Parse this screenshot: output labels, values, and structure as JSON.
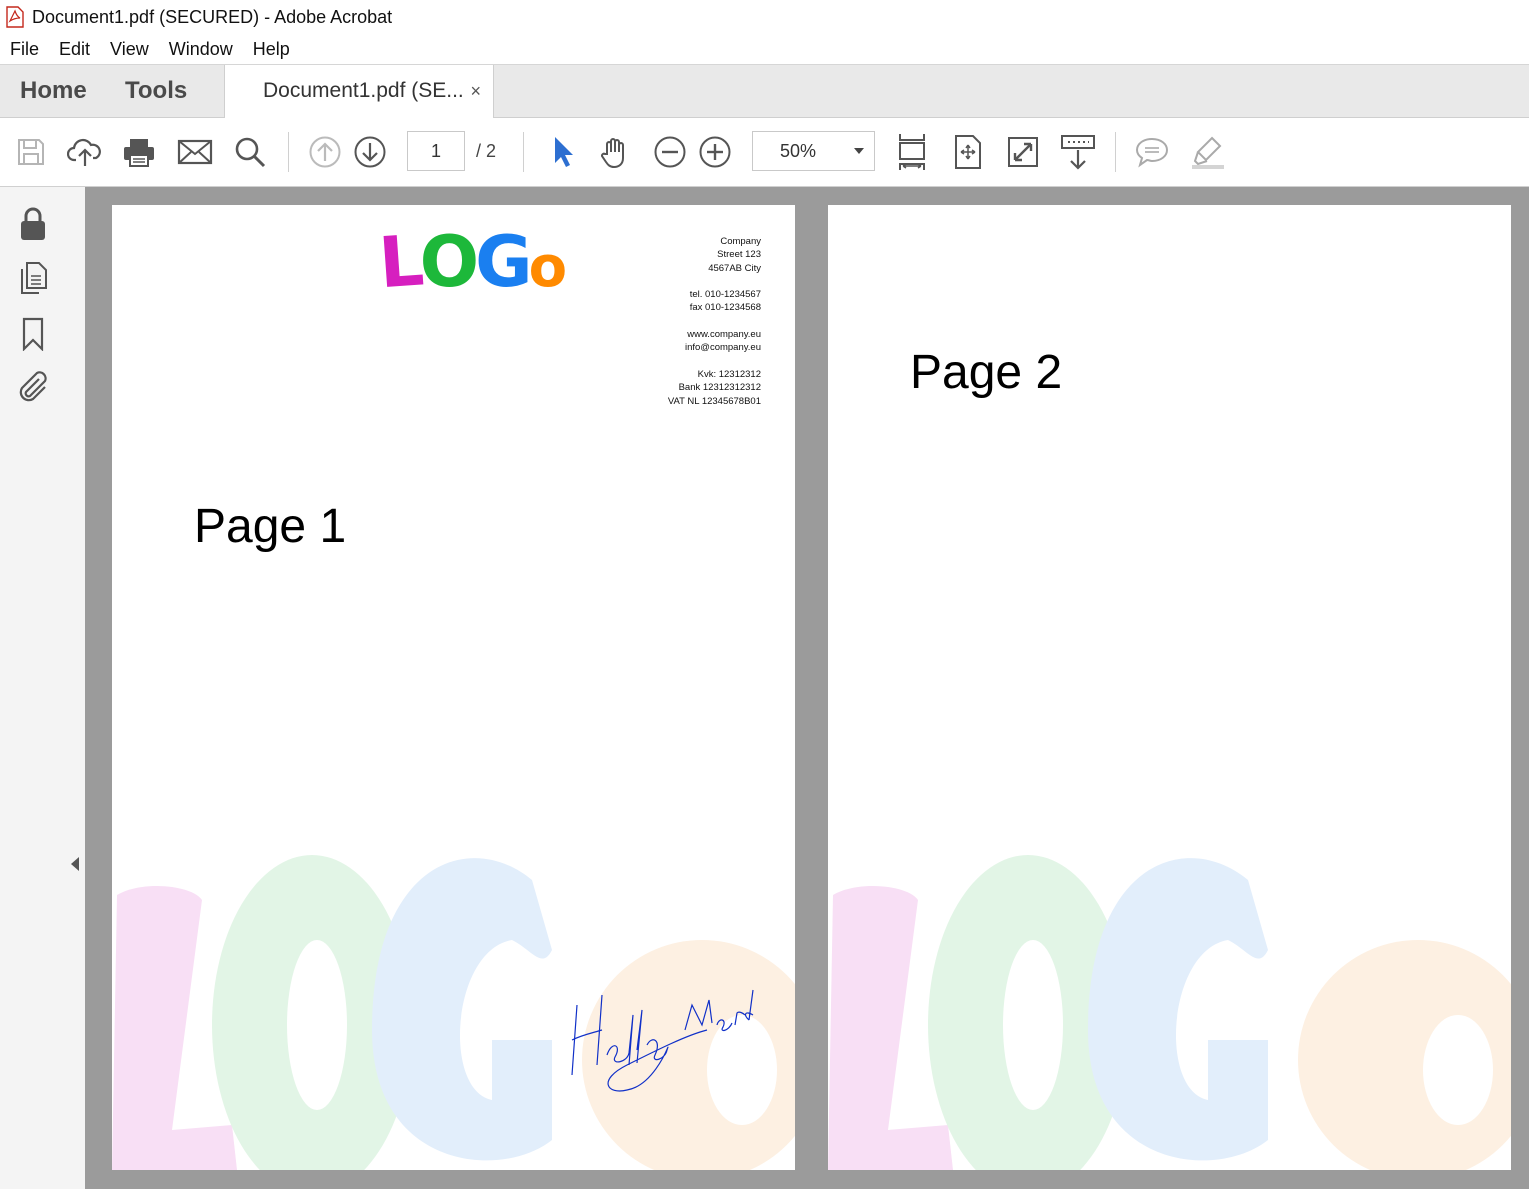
{
  "window": {
    "title": "Document1.pdf (SECURED) - Adobe Acrobat"
  },
  "menu": [
    "File",
    "Edit",
    "View",
    "Window",
    "Help"
  ],
  "tabs": {
    "home": "Home",
    "tools": "Tools",
    "document": "Document1.pdf (SE...",
    "close": "×"
  },
  "toolbar": {
    "page_current": "1",
    "page_total": "/ 2",
    "zoom": "50%",
    "icons": [
      "save-icon",
      "upload-cloud-icon",
      "print-icon",
      "email-icon",
      "search-icon",
      "page-up-icon",
      "page-down-icon",
      "select-cursor-icon",
      "hand-tool-icon",
      "zoom-out-icon",
      "zoom-in-icon",
      "fit-page-icon",
      "rotate-page-icon",
      "full-screen-icon",
      "read-mode-icon",
      "comment-icon",
      "highlight-pen-icon"
    ]
  },
  "sidebar": {
    "icons": [
      "lock-icon",
      "pages-icon",
      "bookmark-icon",
      "attachment-icon"
    ]
  },
  "pages": [
    {
      "label": "Page 1",
      "logo": "LOGO",
      "address": [
        "Company",
        "Street 123",
        "4567AB City",
        "",
        "tel. 010-1234567",
        "fax 010-1234568",
        "",
        "www.company.eu",
        "info@company.eu",
        "",
        "Kvk: 12312312",
        "Bank 12312312312",
        "VAT NL 12345678B01"
      ],
      "signature": "Hello World"
    },
    {
      "label": "Page 2"
    }
  ],
  "colors": {
    "accent": "#2d6fd1",
    "viewer_bg": "#9b9b9b",
    "logo_L": "#d61fbf",
    "logo_O": "#1db83a",
    "logo_G": "#1a7ff0",
    "logo_o": "#ff8a00"
  }
}
